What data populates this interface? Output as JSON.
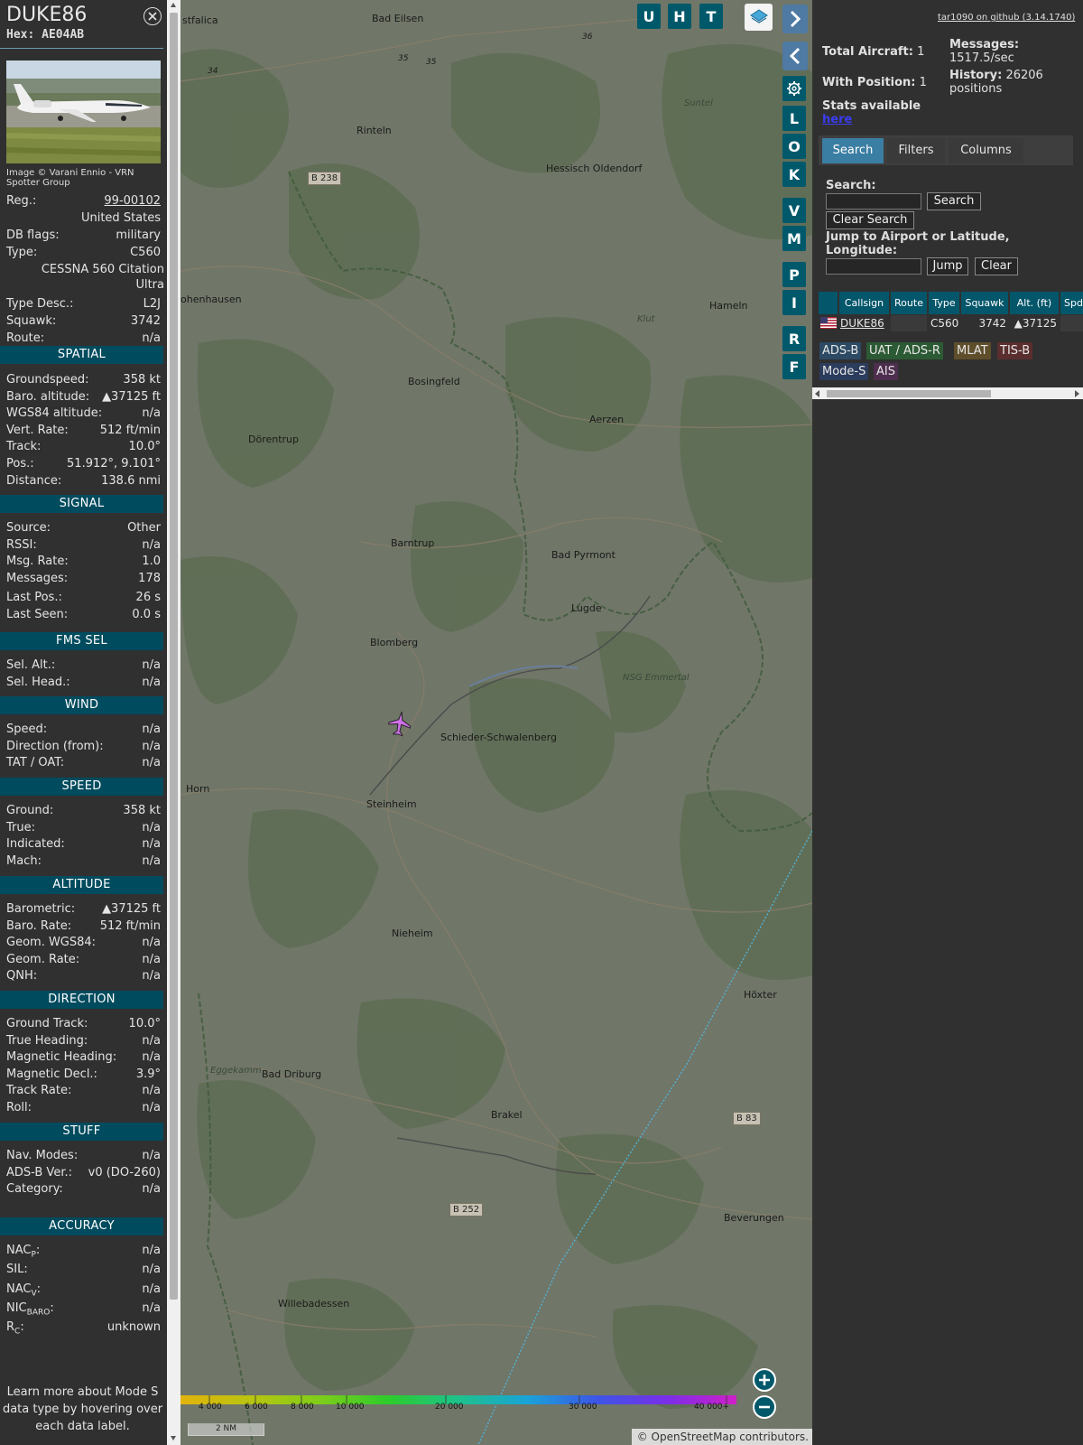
{
  "info": {
    "callsign": "DUKE86",
    "hex_label": "Hex:",
    "hex": "AE04AB",
    "photo_credit": "Image © Varani Ennio - VRN Spotter Group",
    "reg_label": "Reg.:",
    "reg": "99-00102",
    "country": "United States",
    "dbflags_label": "DB flags:",
    "dbflags": "military",
    "type_label": "Type:",
    "type": "C560",
    "type_full": "CESSNA 560 Citation Ultra",
    "typedesc_label": "Type Desc.:",
    "typedesc": "L2J",
    "squawk_label": "Squawk:",
    "squawk": "3742",
    "route_label": "Route:",
    "route": "n/a",
    "learn_more": "Learn more about Mode S data type by hovering over each data label."
  },
  "sections": {
    "spatial": "SPATIAL",
    "signal": "SIGNAL",
    "fms": "FMS SEL",
    "wind": "WIND",
    "speed": "SPEED",
    "altitude": "ALTITUDE",
    "direction": "DIRECTION",
    "stuff": "STUFF",
    "accuracy": "ACCURACY"
  },
  "spatial": [
    {
      "label": "Groundspeed:",
      "value": "358 kt"
    },
    {
      "label": "Baro. altitude:",
      "value": "▲37125 ft"
    },
    {
      "label": "WGS84 altitude:",
      "value": "n/a"
    },
    {
      "label": "Vert. Rate:",
      "value": "512 ft/min"
    },
    {
      "label": "Track:",
      "value": "10.0°"
    },
    {
      "label": "Pos.:",
      "value": "51.912°, 9.101°"
    },
    {
      "label": "Distance:",
      "value": "138.6 nmi"
    }
  ],
  "signal": [
    {
      "label": "Source:",
      "value": "Other"
    },
    {
      "label": "RSSI:",
      "value": "n/a"
    },
    {
      "label": "Msg. Rate:",
      "value": "1.0"
    },
    {
      "label": "Messages:",
      "value": "178"
    },
    {
      "label": "Last Pos.:",
      "value": "26 s"
    },
    {
      "label": "Last Seen:",
      "value": "0.0 s"
    }
  ],
  "fms": [
    {
      "label": "Sel. Alt.:",
      "value": "n/a"
    },
    {
      "label": "Sel. Head.:",
      "value": "n/a"
    }
  ],
  "wind": [
    {
      "label": "Speed:",
      "value": "n/a"
    },
    {
      "label": "Direction (from):",
      "value": "n/a"
    },
    {
      "label": "TAT / OAT:",
      "value": "n/a"
    }
  ],
  "speed": [
    {
      "label": "Ground:",
      "value": "358 kt"
    },
    {
      "label": "True:",
      "value": "n/a"
    },
    {
      "label": "Indicated:",
      "value": "n/a"
    },
    {
      "label": "Mach:",
      "value": "n/a"
    }
  ],
  "altitude": [
    {
      "label": "Barometric:",
      "value": "▲37125 ft"
    },
    {
      "label": "Baro. Rate:",
      "value": "512 ft/min"
    },
    {
      "label": "Geom. WGS84:",
      "value": "n/a"
    },
    {
      "label": "Geom. Rate:",
      "value": "n/a"
    },
    {
      "label": "QNH:",
      "value": "n/a"
    }
  ],
  "direction": [
    {
      "label": "Ground Track:",
      "value": "10.0°"
    },
    {
      "label": "True Heading:",
      "value": "n/a"
    },
    {
      "label": "Magnetic Heading:",
      "value": "n/a"
    },
    {
      "label": "Magnetic Decl.:",
      "value": "3.9°"
    },
    {
      "label": "Track Rate:",
      "value": "n/a"
    },
    {
      "label": "Roll:",
      "value": "n/a"
    }
  ],
  "stuff": [
    {
      "label": "Nav. Modes:",
      "value": "n/a"
    },
    {
      "label": "ADS-B Ver.:",
      "value": "v0 (DO-260)"
    },
    {
      "label": "Category:",
      "value": "n/a"
    }
  ],
  "accuracy": [
    {
      "label": "NAC",
      "sub": "P",
      "value": "n/a"
    },
    {
      "label": "SIL:",
      "sub": "",
      "value": "n/a"
    },
    {
      "label": "NAC",
      "sub": "V",
      "value": "n/a"
    },
    {
      "label": "NIC",
      "sub": "BARO",
      "value": "n/a"
    },
    {
      "label": "R",
      "sub": "C",
      "value": "unknown"
    }
  ],
  "map": {
    "buttons": [
      "U",
      "H",
      "T",
      "L",
      "O",
      "K",
      "V",
      "M",
      "P",
      "I",
      "R",
      "F"
    ],
    "places": [
      {
        "name": "stfalica"
      },
      {
        "name": "Bad Eilsen"
      },
      {
        "name": "Rinteln"
      },
      {
        "name": "Hessisch Oldendorf"
      },
      {
        "name": "Suntel"
      },
      {
        "name": "ohenhausen"
      },
      {
        "name": "Hameln"
      },
      {
        "name": "Klut"
      },
      {
        "name": "Bosingfeld"
      },
      {
        "name": "Aerzen"
      },
      {
        "name": "Dörentrup"
      },
      {
        "name": "Barntrup"
      },
      {
        "name": "Bad Pyrmont"
      },
      {
        "name": "Lugde"
      },
      {
        "name": "Blomberg"
      },
      {
        "name": "NSG Emmertal"
      },
      {
        "name": "Schieder-Schwalenberg"
      },
      {
        "name": "Horn"
      },
      {
        "name": "Steinheim"
      },
      {
        "name": "Nieheim"
      },
      {
        "name": "Höxter"
      },
      {
        "name": "Eggekamm"
      },
      {
        "name": "Bad Driburg"
      },
      {
        "name": "Brakel"
      },
      {
        "name": "Beverungen"
      },
      {
        "name": "Willebadessen"
      }
    ],
    "roads": [
      "B 238",
      "B 83",
      "B 252"
    ],
    "road_numbers": [
      "36",
      "35",
      "35",
      "34"
    ],
    "colorbar_labels": [
      "4 000",
      "6 000",
      "8 000",
      "10 000",
      "20 000",
      "30 000",
      "40 000+"
    ],
    "colorbar_colors": [
      "#e3b30c",
      "#b9c410",
      "#7fcd1a",
      "#2ccc2c",
      "#1ec28c",
      "#1aa2d8",
      "#3d55e6",
      "#7a2ee8",
      "#d020c8"
    ],
    "scale": "2 NM",
    "attribution": "© OpenStreetMap contributors."
  },
  "stats": {
    "github": "tar1090 on github (3.14.1740)",
    "total_label": "Total Aircraft:",
    "total": "1",
    "messages_label": "Messages:",
    "messages": "1517.5/sec",
    "withpos_label": "With Position:",
    "withpos": "1",
    "history_label": "History:",
    "history": "26206 positions",
    "stats_text": "Stats available",
    "stats_link": "here"
  },
  "tabs": [
    "Search",
    "Filters",
    "Columns"
  ],
  "search": {
    "label": "Search:",
    "button": "Search",
    "clear": "Clear Search",
    "jump_label": "Jump to Airport or Latitude, Longitude:",
    "jump": "Jump",
    "jump_clear": "Clear"
  },
  "table": {
    "headers": [
      "Callsign",
      "Route",
      "Type",
      "Squawk",
      "Alt. (ft)",
      "Spd"
    ],
    "rows": [
      {
        "callsign": "DUKE86",
        "route": "",
        "type": "C560",
        "squawk": "3742",
        "alt": "▲37125"
      }
    ]
  },
  "legend": [
    {
      "label": "ADS-B",
      "color": "#2c4a63"
    },
    {
      "label": "UAT / ADS-R",
      "color": "#2c5a34"
    },
    {
      "label": "MLAT",
      "color": "#5f4e2b"
    },
    {
      "label": "TIS-B",
      "color": "#5a2e2e"
    },
    {
      "label": "Mode-S",
      "color": "#2c3c5c"
    },
    {
      "label": "AIS",
      "color": "#4e2e4e"
    }
  ]
}
